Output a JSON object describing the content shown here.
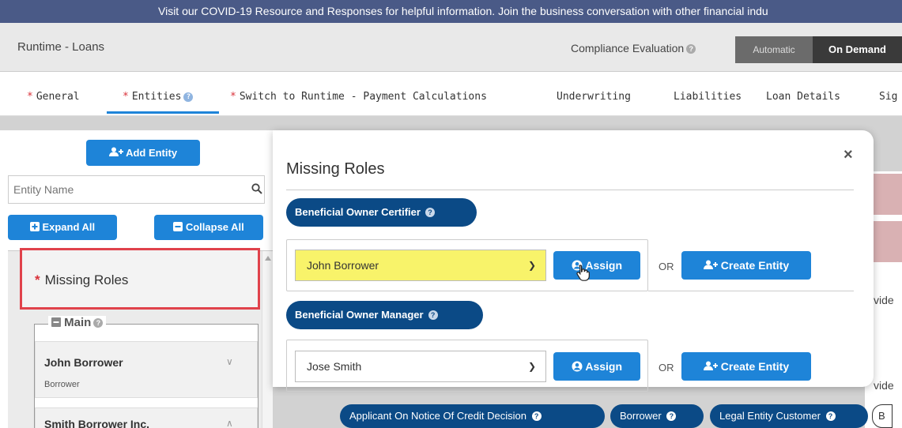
{
  "banner": {
    "text": "Visit our COVID-19 Resource and Responses for helpful information. Join the business conversation with other financial indu"
  },
  "app": {
    "title": "Runtime - Loans",
    "compliance_label": "Compliance Evaluation",
    "mode_automatic": "Automatic",
    "mode_on_demand": "On Demand"
  },
  "tabs": {
    "general": "General",
    "entities": "Entities",
    "payment_calc": "Switch to Runtime - Payment Calculations",
    "underwriting": "Underwriting",
    "liabilities": "Liabilities",
    "loan_details": "Loan Details",
    "truncated": "Sig"
  },
  "sidebar": {
    "add_entity_label": "Add Entity",
    "search_placeholder": "Entity Name",
    "expand_all_label": "Expand All",
    "collapse_all_label": "Collapse All",
    "missing_roles_label": "Missing Roles",
    "group_label": "Main",
    "entities": [
      {
        "name": "John Borrower",
        "role": "Borrower"
      },
      {
        "name": "Smith Borrower Inc.",
        "role": ""
      }
    ]
  },
  "modal": {
    "title": "Missing Roles",
    "close_glyph": "×",
    "roles": [
      {
        "label": "Beneficial Owner Certifier",
        "selected": "John Borrower",
        "assign_label": "Assign",
        "or_label": "OR",
        "create_label": "Create Entity"
      },
      {
        "label": "Beneficial Owner Manager",
        "selected": "Jose Smith",
        "assign_label": "Assign",
        "or_label": "OR",
        "create_label": "Create Entity"
      }
    ]
  },
  "background": {
    "partial_text_1": "vide",
    "partial_text_2": "vide",
    "pills": [
      "Applicant On Notice Of Credit Decision",
      "Borrower",
      "Legal Entity Customer",
      "B"
    ]
  },
  "colors": {
    "banner": "#4a5a87",
    "primary": "#1e84d8",
    "pill_dark": "#0b4a86",
    "required": "#d9323a",
    "highlight": "#f8f36a",
    "callout": "#e0424b"
  }
}
